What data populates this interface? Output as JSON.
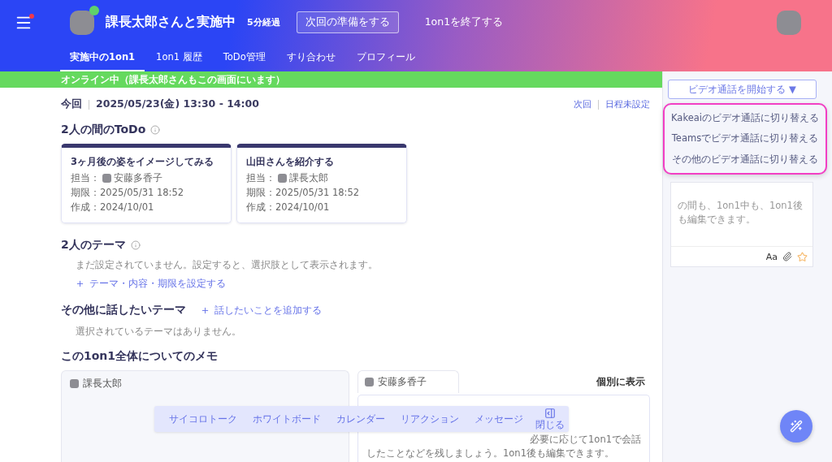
{
  "header": {
    "title": "課長太郎さんと実施中",
    "elapsed": "5分経過",
    "prepare_button": "次回の準備をする",
    "end_button": "1on1を終了する",
    "menu_notification": true,
    "partner_online": true
  },
  "tabs": [
    {
      "label": "実施中の1on1",
      "selected": true
    },
    {
      "label": "1on1 履歴",
      "selected": false
    },
    {
      "label": "ToDo管理",
      "selected": false
    },
    {
      "label": "すり合わせ",
      "selected": false
    },
    {
      "label": "プロフィール",
      "selected": false
    }
  ],
  "status_banner": "オンライン中（課長太郎さんもこの画面にいます）",
  "session": {
    "label": "今回",
    "datetime": "2025/05/23(金) 13:30 - 14:00",
    "next_label": "次回",
    "next_value": "日程未設定"
  },
  "todo": {
    "title": "2人の間のToDo",
    "cards": [
      {
        "title": "3ヶ月後の姿をイメージしてみる",
        "assignee_label": "担当：",
        "assignee": "安藤多香子",
        "due": "期限：2025/05/31 18:52",
        "created": "作成：2024/10/01"
      },
      {
        "title": "山田さんを紹介する",
        "assignee_label": "担当：",
        "assignee": "課長太郎",
        "due": "期限：2025/05/31 18:52",
        "created": "作成：2024/10/01"
      }
    ]
  },
  "theme": {
    "title": "2人のテーマ",
    "empty_text": "まだ設定されていません。設定すると、選択肢として表示されます。",
    "add_link": "テーマ・内容・期限を設定する"
  },
  "other_themes": {
    "title": "その他に話したいテーマ",
    "add_link": "話したいことを追加する",
    "empty_text": "選択されているテーマはありません。"
  },
  "memo": {
    "title": "この1on1全体についてのメモ",
    "tabs": [
      {
        "name": "課長太郎"
      },
      {
        "name": "安藤多香子"
      }
    ],
    "view_toggle": "個別に表示",
    "text_line_1": "必要に応じて1on1で会話",
    "text_line_2": "したことなどを残しましょう。1on1後も編集できます。"
  },
  "floating_toolbar": {
    "items": [
      "サイコロトーク",
      "ホワイトボード",
      "カレンダー",
      "リアクション",
      "メッセージ"
    ],
    "close": "閉じる"
  },
  "sidebar": {
    "video_button": "ビデオ通話を開始する ▼",
    "menu": [
      "Kakeaiのビデオ通話に切り替える",
      "Teamsでビデオ通話に切り替える",
      "その他のビデオ通話に切り替える"
    ],
    "note_text": "の間も、1on1中も、1on1後も編集できます。",
    "format_label": "Aa"
  }
}
